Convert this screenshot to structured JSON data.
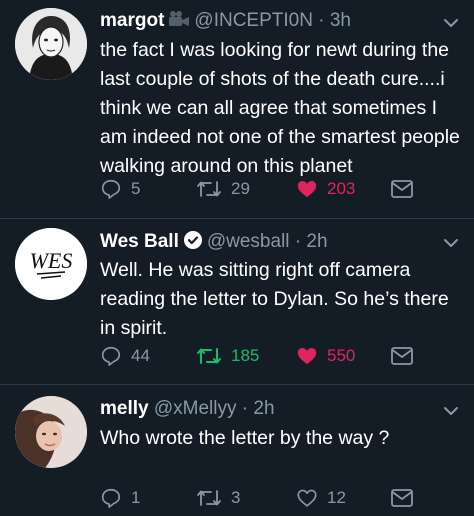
{
  "tweets": [
    {
      "name": "margot",
      "handle": "@INCEPTI0N",
      "time": "3h",
      "text": "the fact I was looking for newt during the last couple of shots of the death cure....i think we can all agree that sometimes I am indeed not one of the smartest people walking around on this planet",
      "replies": "5",
      "retweets": "29",
      "likes": "203",
      "liked": true,
      "retweeted": false
    },
    {
      "name": "Wes Ball",
      "handle": "@wesball",
      "time": "2h",
      "verified": true,
      "avatar_text": "WES",
      "text": "Well. He was sitting right off camera reading the letter to Dylan. So he’s there in spirit.",
      "replies": "44",
      "retweets": "185",
      "likes": "550",
      "liked": true,
      "retweeted": true
    },
    {
      "name": "melly",
      "handle": "@xMellyy",
      "time": "2h",
      "text": "Who wrote the letter by the way ?",
      "replies": "1",
      "retweets": "3",
      "likes": "12",
      "liked": false,
      "retweeted": false
    }
  ],
  "colors": {
    "background": "#141d26",
    "muted": "#8899a6",
    "like": "#e0245e",
    "retweet": "#17bf63",
    "verified": "#ffffff"
  }
}
